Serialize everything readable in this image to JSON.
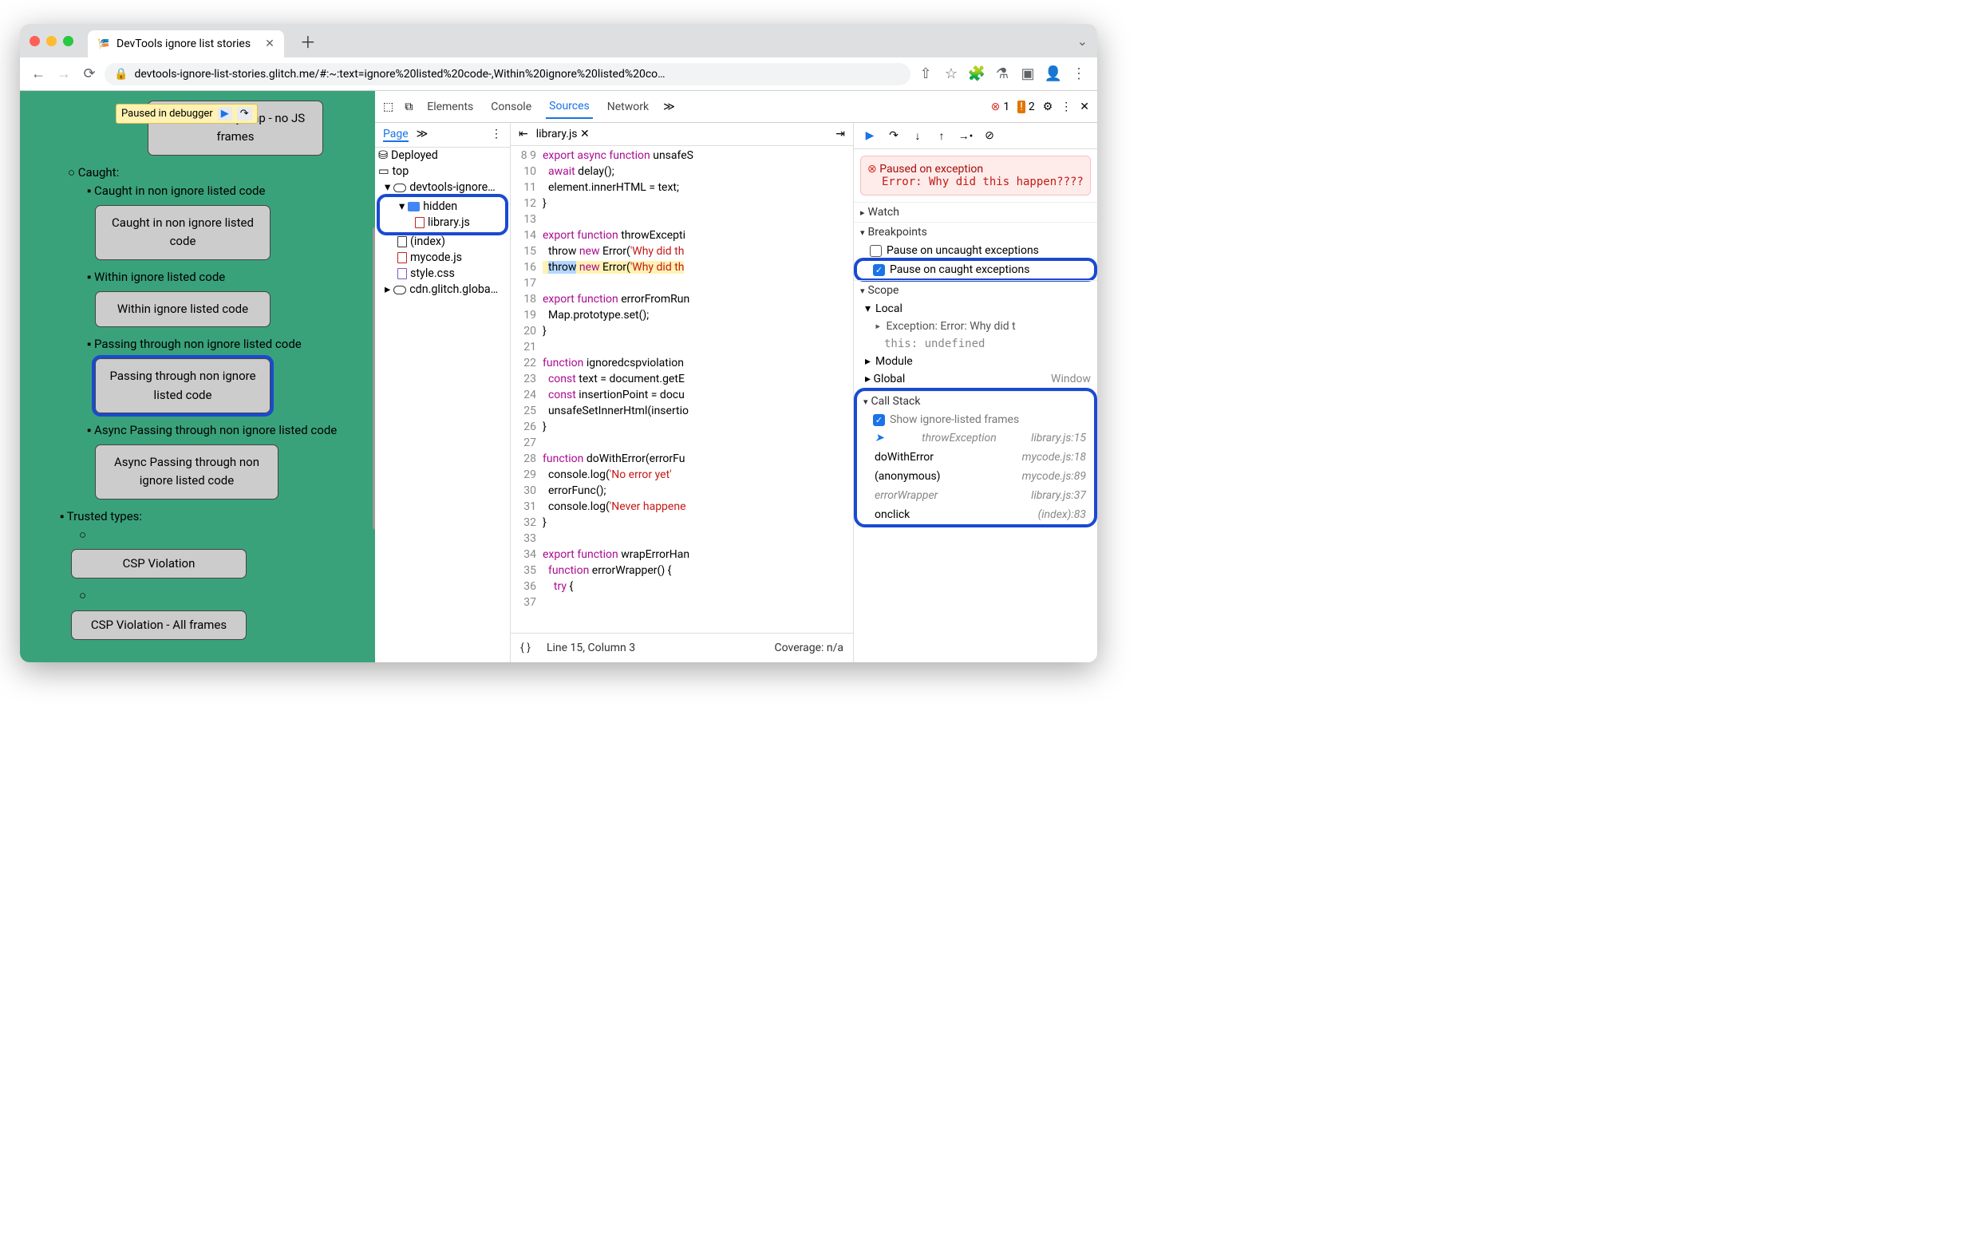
{
  "browser": {
    "tab_title": "DevTools ignore list stories",
    "url": "devtools-ignore-list-stories.glitch.me/#:~:text=ignore%20listed%20code-,Within%20ignore%20listed%20co…"
  },
  "toast": {
    "label": "Paused in debugger"
  },
  "tree": {
    "btn1": "WebAssembly trap - no JS frames",
    "caught": "Caught:",
    "i1": "Caught in non ignore listed code",
    "b1": "Caught in non ignore listed code",
    "i2": "Within ignore listed code",
    "b2": "Within ignore listed code",
    "i3": "Passing through non ignore listed code",
    "b3": "Passing through non ignore listed code",
    "i4": "Async Passing through non ignore listed code",
    "b4": "Async Passing through non ignore listed code",
    "tt": "Trusted types:",
    "b5": "CSP Violation",
    "b6": "CSP Violation - All frames"
  },
  "dt": {
    "tabs": {
      "elements": "Elements",
      "console": "Console",
      "sources": "Sources",
      "network": "Network"
    },
    "errors": "1",
    "warnings": "2",
    "page": "Page"
  },
  "files": {
    "deployed": "Deployed",
    "top": "top",
    "domain": "devtools-ignore…",
    "hidden": "hidden",
    "lib": "library.js",
    "index": "(index)",
    "mycode": "mycode.js",
    "style": "style.css",
    "cdn": "cdn.glitch.globa…"
  },
  "editor": {
    "file": "library.js",
    "lines": [
      8,
      9,
      10,
      11,
      12,
      13,
      14,
      15,
      16,
      17,
      18,
      19,
      20,
      21,
      22,
      23,
      24,
      25,
      26,
      27,
      28,
      29,
      30,
      31,
      32,
      33,
      34,
      35,
      36,
      37
    ],
    "code": "export async function unsafeS\n  await delay();\n  element.innerHTML = text;\n}\n\nexport function throwExcepti\n  throw new Error('Why did th\n}\n\nexport function errorFromRun\n  Map.prototype.set();\n}\n\nfunction ignoredcspviolation\n  const text = document.getE\n  const insertionPoint = docu\n  unsafeSetInnerHtml(insertio\n}\n\nfunction doWithError(errorFu\n  console.log('No error yet'\n  errorFunc();\n  console.log('Never happene\n}\n\nexport function wrapErrorHan\n  function errorWrapper() {\n    try {",
    "status_pretty": "{ }",
    "status_pos": "Line 15, Column 3",
    "status_cov": "Coverage: n/a"
  },
  "dbg": {
    "paused_title": "Paused on exception",
    "paused_msg": "Error: Why did this happen????",
    "watch": "Watch",
    "breakpoints": "Breakpoints",
    "bp_uncaught": "Pause on uncaught exceptions",
    "bp_caught": "Pause on caught exceptions",
    "scope": "Scope",
    "local": "Local",
    "exc_line": "Exception: Error: Why did t",
    "this_line": "this: undefined",
    "module": "Module",
    "global": "Global",
    "global_v": "Window",
    "callstack": "Call Stack",
    "show_frames": "Show ignore-listed frames",
    "stack": [
      {
        "name": "throwException",
        "loc": "library.js:15",
        "ign": true,
        "cur": true
      },
      {
        "name": "doWithError",
        "loc": "mycode.js:18"
      },
      {
        "name": "(anonymous)",
        "loc": "mycode.js:89"
      },
      {
        "name": "errorWrapper",
        "loc": "library.js:37",
        "ign": true
      },
      {
        "name": "onclick",
        "loc": "(index):83"
      }
    ]
  }
}
